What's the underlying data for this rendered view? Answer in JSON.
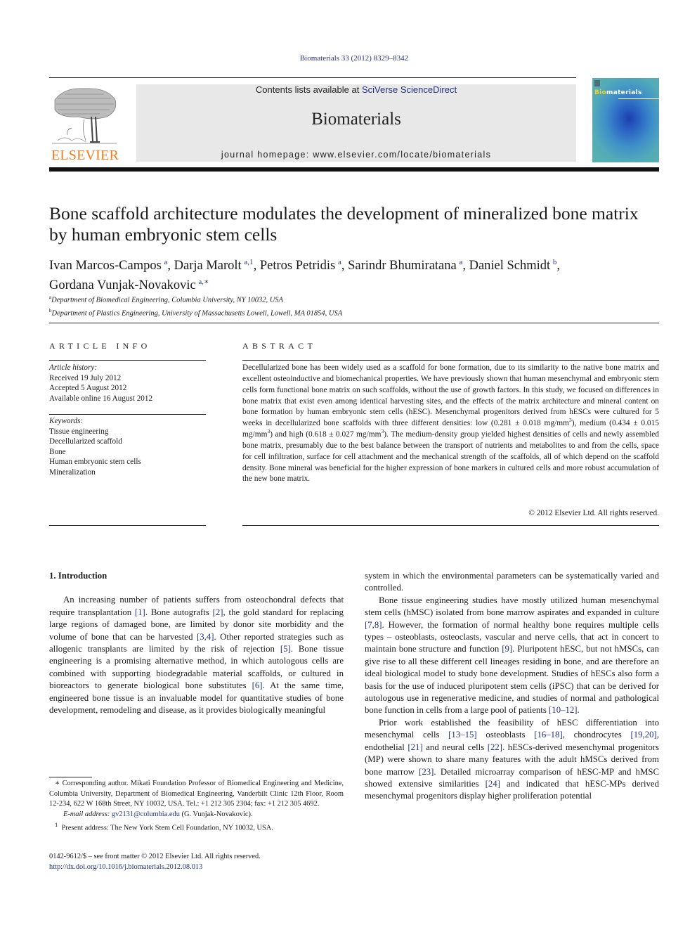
{
  "header": {
    "citation": "Biomaterials 33 (2012) 8329–8342",
    "publisher_logo_text": "ELSEVIER",
    "contents_prefix": "Contents lists available at ",
    "contents_link": "SciVerse ScienceDirect",
    "journal_name": "Biomaterials",
    "homepage_label": "journal homepage: ",
    "homepage_url": "www.elsevier.com/locate/biomaterials",
    "cover_title_bi": "Bio",
    "cover_title_rest": "materials"
  },
  "article": {
    "title": "Bone scaffold architecture modulates the development of mineralized bone matrix by human embryonic stem cells",
    "authors": [
      {
        "name": "Ivan Marcos-Campos",
        "sup": "a",
        "sep": ", "
      },
      {
        "name": "Darja Marolt",
        "sup": "a,1",
        "sep": ", "
      },
      {
        "name": "Petros Petridis",
        "sup": "a",
        "sep": ", "
      },
      {
        "name": "Sarindr Bhumiratana",
        "sup": "a",
        "sep": ", "
      },
      {
        "name": "Daniel Schmidt",
        "sup": "b",
        "sep": ","
      },
      {
        "name": "Gordana Vunjak-Novakovic",
        "sup": "a,∗",
        "sep": ""
      }
    ],
    "affiliations": [
      {
        "mark": "a",
        "text": "Department of Biomedical Engineering, Columbia University, NY 10032, USA"
      },
      {
        "mark": "b",
        "text": "Department of Plastics Engineering, University of Massachusetts Lowell, Lowell, MA 01854, USA"
      }
    ]
  },
  "article_info": {
    "heading": "ARTICLE INFO",
    "history_label": "Article history:",
    "history": [
      "Received 19 July 2012",
      "Accepted 5 August 2012",
      "Available online 16 August 2012"
    ],
    "keywords_label": "Keywords:",
    "keywords": [
      "Tissue engineering",
      "Decellularized scaffold",
      "Bone",
      "Human embryonic stem cells",
      "Mineralization"
    ]
  },
  "abstract": {
    "heading": "ABSTRACT",
    "part1": "Decellularized bone has been widely used as a scaffold for bone formation, due to its similarity to the native bone matrix and excellent osteoinductive and biomechanical properties. We have previously shown that human mesenchymal and embryonic stem cells form functional bone matrix on such scaffolds, without the use of growth factors. In this study, we focused on differences in bone matrix that exist even among identical harvesting sites, and the effects of the matrix architecture and mineral content on bone formation by human embryonic stem cells (hESC). Mesenchymal progenitors derived from hESCs were cultured for 5 weeks in decellularized bone scaffolds with three different densities: low (0.281 ± 0.018 mg/mm",
    "part2": "), medium (0.434 ± 0.015 mg/mm",
    "part3": ") and high (0.618 ± 0.027 mg/mm",
    "part4": "). The medium-density group yielded highest densities of cells and newly assembled bone matrix, presumably due to the best balance between the transport of nutrients and metabolites to and from the cells, space for cell infiltration, surface for cell attachment and the mechanical strength of the scaffolds, all of which depend on the scaffold density. Bone mineral was beneficial for the higher expression of bone markers in cultured cells and more robust accumulation of the new bone matrix.",
    "cube_sup": "3",
    "copyright": "© 2012 Elsevier Ltd. All rights reserved."
  },
  "body": {
    "section_heading": "1.  Introduction",
    "left_para": [
      {
        "t": "An increasing number of patients suffers from osteochondral defects that require transplantation "
      },
      {
        "ref": "[1]"
      },
      {
        "t": ". Bone autografts "
      },
      {
        "ref": "[2]"
      },
      {
        "t": ", the gold standard for replacing large regions of damaged bone, are limited by donor site morbidity and the volume of bone that can be harvested "
      },
      {
        "ref": "[3,4]"
      },
      {
        "t": ". Other reported strategies such as allogenic transplants are limited by the risk of rejection "
      },
      {
        "ref": "[5]"
      },
      {
        "t": ". Bone tissue engineering is a promising alternative method, in which autologous cells are combined with supporting biodegradable material scaffolds, or cultured in bioreactors to generate biological bone substitutes "
      },
      {
        "ref": "[6]"
      },
      {
        "t": ". At the same time, engineered bone tissue is an invaluable model for quantitative studies of bone development, remodeling and disease, as it provides biologically meaningful"
      }
    ],
    "right_para1": "system in which the environmental parameters can be systematically varied and controlled.",
    "right_para2": [
      {
        "t": "Bone tissue engineering studies have mostly utilized human mesenchymal stem cells (hMSC) isolated from bone marrow aspirates and expanded in culture "
      },
      {
        "ref": "[7,8]"
      },
      {
        "t": ". However, the formation of normal healthy bone requires multiple cells types – osteoblasts, osteoclasts, vascular and nerve cells, that act in concert to maintain bone structure and function "
      },
      {
        "ref": "[9]"
      },
      {
        "t": ". Pluripotent hESC, but not hMSCs, can give rise to all these different cell lineages residing in bone, and are therefore an ideal biological model to study bone development. Studies of hESCs also form a basis for the use of induced pluripotent stem cells (iPSC) that can be derived for autologous use in regenerative medicine, and studies of normal and pathological bone function in cells from a large pool of patients "
      },
      {
        "ref": "[10–12]"
      },
      {
        "t": "."
      }
    ],
    "right_para3": [
      {
        "t": "Prior work established the feasibility of hESC differentiation into mesenchymal cells "
      },
      {
        "ref": "[13–15]"
      },
      {
        "t": " osteoblasts "
      },
      {
        "ref": "[16–18]"
      },
      {
        "t": ", chondrocytes "
      },
      {
        "ref": "[19,20]"
      },
      {
        "t": ", endothelial "
      },
      {
        "ref": "[21]"
      },
      {
        "t": " and neural cells "
      },
      {
        "ref": "[22]"
      },
      {
        "t": ". hESCs-derived mesenchymal progenitors (MP) were shown to share many features with the adult hMSCs derived from bone marrow "
      },
      {
        "ref": "[23]"
      },
      {
        "t": ". Detailed microarray comparison of hESC-MP and hMSC showed extensive similarities "
      },
      {
        "ref": "[24]"
      },
      {
        "t": " and indicated that hESC-MPs derived mesenchymal progenitors display higher proliferation potential"
      }
    ]
  },
  "footnotes": {
    "corresponding": "∗ Corresponding author. Mikati Foundation Professor of Biomedical Engineering and Medicine, Columbia University, Department of Biomedical Engineering, Vanderbilt Clinic 12th Floor, Room 12-234, 622 W 168th Street, NY 10032, USA. Tel.: +1 212 305 2304; fax: +1 212 305 4692.",
    "email_label": "E-mail address: ",
    "email": "gv2131@columbia.edu",
    "email_suffix": " (G. Vunjak-Novakovic).",
    "present_mark": "1",
    "present": "Present address: The New York Stem Cell Foundation, NY 10032, USA."
  },
  "bottom": {
    "issn_line": "0142-9612/$ – see front matter © 2012 Elsevier Ltd. All rights reserved.",
    "doi": "http://dx.doi.org/10.1016/j.biomaterials.2012.08.013"
  },
  "colors": {
    "link": "#24307e",
    "elsevier_orange": "#f07b1d",
    "journal_box": "#e8e8e8"
  }
}
